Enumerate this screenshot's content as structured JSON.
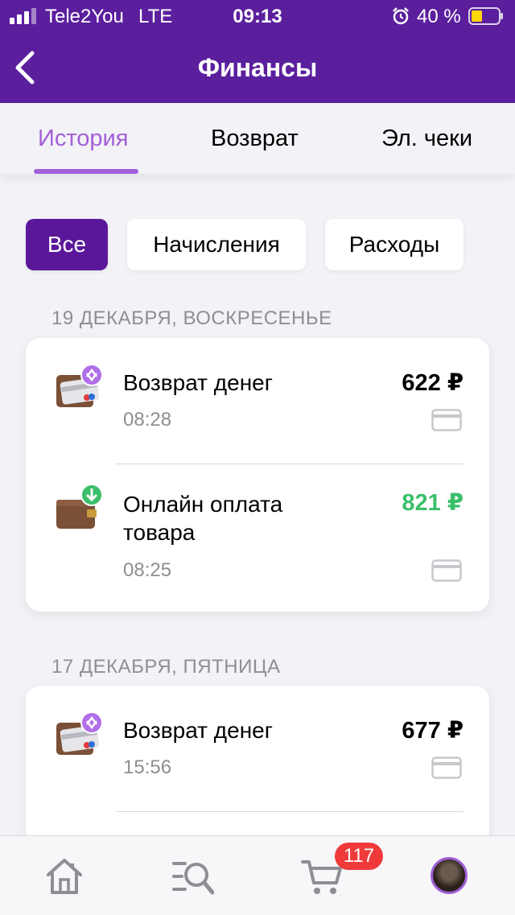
{
  "status_bar": {
    "carrier": "Tele2You",
    "network": "LTE",
    "time": "09:13",
    "battery_percent": "40 %",
    "battery_color": "#ffd60a",
    "icons": [
      "signal-icon",
      "alarm-icon",
      "battery-icon"
    ]
  },
  "header": {
    "title": "Финансы",
    "back_icon": "chevron-left-icon",
    "background": "#5b1f9e"
  },
  "tabs": [
    {
      "label": "История",
      "active": true
    },
    {
      "label": "Возврат",
      "active": false
    },
    {
      "label": "Эл. чеки",
      "active": false
    }
  ],
  "filters": [
    {
      "label": "Все",
      "active": true
    },
    {
      "label": "Начисления",
      "active": false
    },
    {
      "label": "Расходы",
      "active": false
    }
  ],
  "groups": [
    {
      "date": "19 ДЕКАБРЯ, ВОСКРЕСЕНЬЕ",
      "transactions": [
        {
          "title": "Возврат денег",
          "time": "08:28",
          "amount": "622 ₽",
          "icon": "wallet-refund-icon",
          "payment_icon": "card-icon"
        },
        {
          "title": "Онлайн оплата товара",
          "time": "08:25",
          "amount": "821 ₽",
          "amount_color": "#3bbf6a",
          "icon": "wallet-download-icon",
          "payment_icon": "card-icon"
        }
      ]
    },
    {
      "date": "17 ДЕКАБРЯ, ПЯТНИЦА",
      "transactions": [
        {
          "title": "Возврат денег",
          "time": "15:56",
          "amount": "677 ₽",
          "icon": "wallet-refund-icon",
          "payment_icon": "card-icon"
        }
      ]
    }
  ],
  "bottom_nav": {
    "items": [
      "home-icon",
      "catalog-search-icon",
      "cart-icon",
      "profile-avatar"
    ],
    "cart_badge": "117",
    "accent": "#a25fd7"
  }
}
